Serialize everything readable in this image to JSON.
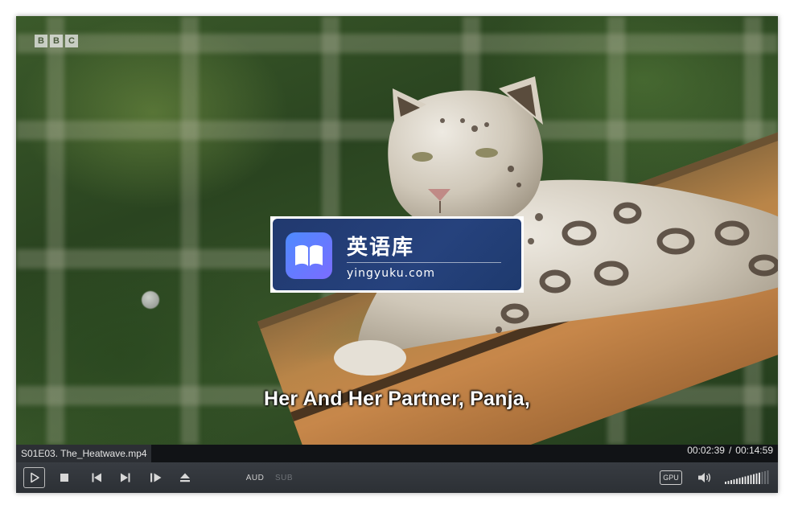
{
  "video": {
    "channel_logo": [
      "B",
      "B",
      "C"
    ],
    "subtitle": "Her And Her Partner, Panja,"
  },
  "watermark": {
    "title": "英语库",
    "url": "yingyuku.com",
    "icon": "open-book-icon"
  },
  "infobar": {
    "filename": "S01E03. The_Heatwave.mp4",
    "elapsed": "00:02:39",
    "separator": "/",
    "duration": "00:14:59"
  },
  "controls": {
    "play": "play-icon",
    "stop": "stop-icon",
    "previous": "skip-previous-icon",
    "next": "skip-next-icon",
    "frame_step": "frame-step-icon",
    "eject": "eject-icon",
    "audio_label": "AUD",
    "subtitle_label": "SUB",
    "gpu_label": "GPU",
    "volume": "speaker-icon",
    "volume_level": 0.8
  },
  "colors": {
    "player_bg": "#1b1d20",
    "controls_bg": "#2c3035",
    "watermark_bg": "#21396f"
  }
}
